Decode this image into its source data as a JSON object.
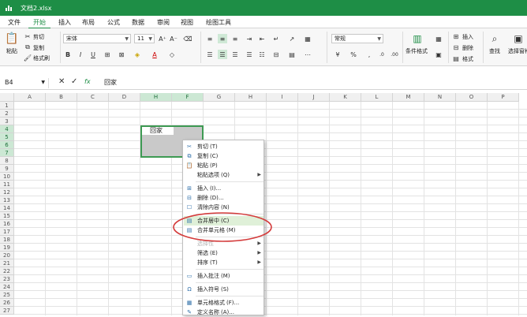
{
  "titlebar": {
    "title": "文档2.xlsx"
  },
  "tabs": [
    {
      "label": "文件",
      "active": false
    },
    {
      "label": "开始",
      "active": true
    },
    {
      "label": "插入",
      "active": false
    },
    {
      "label": "布局",
      "active": false
    },
    {
      "label": "公式",
      "active": false
    },
    {
      "label": "数据",
      "active": false
    },
    {
      "label": "审阅",
      "active": false
    },
    {
      "label": "视图",
      "active": false
    },
    {
      "label": "绘图工具",
      "active": false
    }
  ],
  "ribbon": {
    "paste_label": "粘贴",
    "cut_label": "剪切",
    "copy_label": "复制",
    "format_painter_label": "格式刷",
    "font_name": "宋体",
    "font_size": "11",
    "number_format": "常规",
    "conditional_format_label": "条件格式",
    "insert_label": "插入",
    "delete_label": "删除",
    "format_label": "格式",
    "find_label": "查找",
    "select_pane_label": "选择窗格"
  },
  "formula_bar": {
    "name_box": "B4",
    "fx": "fx",
    "value": "回家"
  },
  "columns": [
    "A",
    "B",
    "C",
    "D",
    "H",
    "F",
    "G",
    "H",
    "I",
    "J",
    "K",
    "L",
    "M",
    "N",
    "O",
    "P"
  ],
  "rows": [
    "1",
    "2",
    "3",
    "4",
    "5",
    "6",
    "7",
    "8",
    "9",
    "10",
    "11",
    "12",
    "13",
    "14",
    "15",
    "16",
    "17",
    "18",
    "19",
    "20",
    "21",
    "22",
    "23",
    "24",
    "25",
    "26",
    "27"
  ],
  "highlight": {
    "cols": [
      4,
      5
    ],
    "rows": [
      3,
      4,
      5,
      6
    ]
  },
  "cell_value": "回家",
  "context_menu": [
    {
      "label": "剪切",
      "key": "(T)",
      "icon": "✂",
      "sub": false,
      "state": "normal"
    },
    {
      "label": "复制",
      "key": "(C)",
      "icon": "⧉",
      "sub": false,
      "state": "normal"
    },
    {
      "label": "粘贴",
      "key": "(P)",
      "icon": "📋",
      "sub": false,
      "state": "normal"
    },
    {
      "label": "粘贴选项",
      "key": "(Q)",
      "icon": "",
      "sub": true,
      "state": "normal"
    },
    {
      "sep": true
    },
    {
      "label": "插入",
      "key": "(I)...",
      "icon": "⊞",
      "sub": false,
      "state": "normal"
    },
    {
      "label": "删除",
      "key": "(D)...",
      "icon": "⊟",
      "sub": false,
      "state": "normal"
    },
    {
      "label": "清除内容",
      "key": "(N)",
      "icon": "☐",
      "sub": false,
      "state": "normal"
    },
    {
      "sep": true
    },
    {
      "label": "合并居中",
      "key": "(C)",
      "icon": "▤",
      "sub": false,
      "state": "highlight"
    },
    {
      "label": "合并单元格",
      "key": "(M)",
      "icon": "▤",
      "sub": false,
      "state": "normal"
    },
    {
      "sep": true
    },
    {
      "label": "选择性",
      "key": "",
      "icon": "",
      "sub": true,
      "state": "disabled"
    },
    {
      "label": "筛选",
      "key": "(E)",
      "icon": "",
      "sub": true,
      "state": "normal"
    },
    {
      "label": "排序",
      "key": "(T)",
      "icon": "",
      "sub": true,
      "state": "normal"
    },
    {
      "sep": true
    },
    {
      "label": "插入批注",
      "key": "(M)",
      "icon": "▭",
      "sub": false,
      "state": "normal"
    },
    {
      "sep": true
    },
    {
      "label": "插入符号",
      "key": "(S)",
      "icon": "Ω",
      "sub": false,
      "state": "normal"
    },
    {
      "sep": true
    },
    {
      "label": "单元格格式",
      "key": "(F)...",
      "icon": "▦",
      "sub": false,
      "state": "normal"
    },
    {
      "label": "定义名称",
      "key": "(A)...",
      "icon": "✎",
      "sub": false,
      "state": "normal"
    }
  ],
  "colors": {
    "brand": "#1e8e46",
    "selection_border": "#3e9a53",
    "callout": "#d43b3b",
    "highlight_header": "#cce8d4"
  }
}
